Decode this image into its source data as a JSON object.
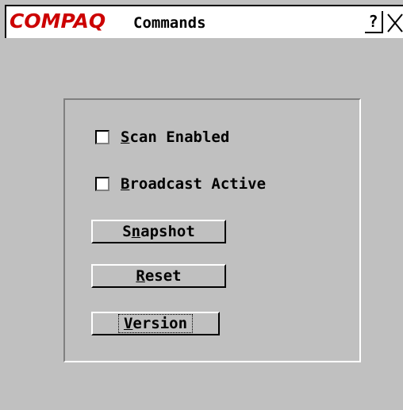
{
  "window": {
    "logo": "COMPAQ",
    "title": "Commands",
    "help_label": "?",
    "close_icon": "close-x-icon"
  },
  "options": {
    "scan": {
      "label_prefix": "",
      "hotkey": "S",
      "label_rest": "can Enabled",
      "checked": false
    },
    "broadcast": {
      "label_prefix": "",
      "hotkey": "B",
      "label_rest": "roadcast Active",
      "checked": false
    }
  },
  "buttons": {
    "snapshot": {
      "prefix": "S",
      "hotkey": "n",
      "rest": "apshot"
    },
    "reset": {
      "prefix": "",
      "hotkey": "R",
      "rest": "eset"
    },
    "version": {
      "prefix": "",
      "hotkey": "V",
      "rest": "ersion",
      "focused": true
    }
  },
  "colors": {
    "brand": "#cc0000",
    "face": "#c0c0c0"
  }
}
